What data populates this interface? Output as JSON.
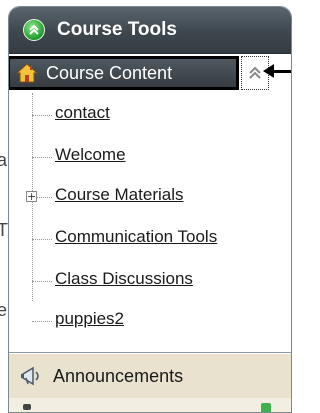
{
  "panel": {
    "title": "Course Tools"
  },
  "course_content": {
    "label": "Course Content"
  },
  "tree": {
    "items": [
      {
        "label": "contact"
      },
      {
        "label": "Welcome"
      },
      {
        "label": "Course Materials"
      },
      {
        "label": "Communication Tools"
      },
      {
        "label": "Class Discussions"
      },
      {
        "label": "puppies2"
      }
    ]
  },
  "tools": {
    "announcements_label": "Announcements"
  },
  "icons": {
    "header": "double-chevron-up-icon",
    "course_content": "home-icon",
    "collapse": "double-chevron-up-icon",
    "expander": "plus-icon",
    "announcements": "megaphone-icon",
    "pointer": "arrow-left-icon"
  },
  "colors": {
    "header_bg": "#3e474e",
    "header_icon": "#1f9a2c",
    "tool_row_bg": "#e8e2cf"
  }
}
